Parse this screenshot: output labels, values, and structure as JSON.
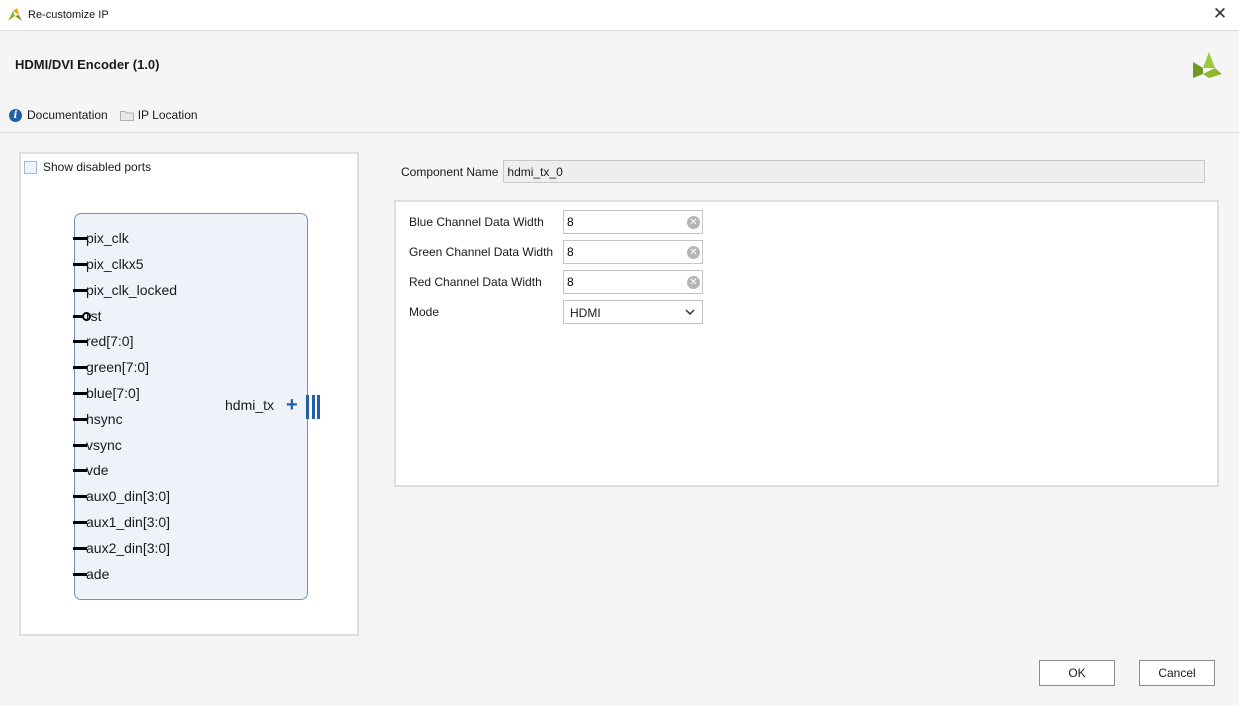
{
  "window": {
    "title": "Re-customize IP",
    "app_icon": "vivado-logo-icon",
    "close_icon": "close-icon"
  },
  "header": {
    "ip_title": "HDMI/DVI Encoder (1.0)",
    "links": [
      {
        "label": "Documentation",
        "icon": "info-icon"
      },
      {
        "label": "IP Location",
        "icon": "folder-icon"
      }
    ]
  },
  "symbol": {
    "show_disabled_ports_label": "Show disabled ports",
    "show_disabled_ports_checked": false,
    "ports": [
      {
        "name": "pix_clk",
        "active_low": false
      },
      {
        "name": "pix_clkx5",
        "active_low": false
      },
      {
        "name": "pix_clk_locked",
        "active_low": false
      },
      {
        "name": "rst",
        "active_low": true
      },
      {
        "name": "red[7:0]",
        "active_low": false
      },
      {
        "name": "green[7:0]",
        "active_low": false
      },
      {
        "name": "blue[7:0]",
        "active_low": false
      },
      {
        "name": "hsync",
        "active_low": false
      },
      {
        "name": "vsync",
        "active_low": false
      },
      {
        "name": "vde",
        "active_low": false
      },
      {
        "name": "aux0_din[3:0]",
        "active_low": false
      },
      {
        "name": "aux1_din[3:0]",
        "active_low": false
      },
      {
        "name": "aux2_din[3:0]",
        "active_low": false
      },
      {
        "name": "ade",
        "active_low": false
      }
    ],
    "output_interface": "hdmi_tx"
  },
  "component_name": {
    "label": "Component Name",
    "value": "hdmi_tx_0"
  },
  "params": [
    {
      "label": "Blue Channel Data Width",
      "value": "8",
      "type": "number"
    },
    {
      "label": "Green Channel Data Width",
      "value": "8",
      "type": "number"
    },
    {
      "label": "Red Channel Data Width",
      "value": "8",
      "type": "number"
    },
    {
      "label": "Mode",
      "value": "HDMI",
      "type": "select"
    }
  ],
  "buttons": {
    "ok": "OK",
    "cancel": "Cancel"
  },
  "colors": {
    "accent": "#1f5fa8",
    "block_fill": "#eef3f9",
    "block_border": "#6f93b8",
    "brand": "#8db92e"
  }
}
